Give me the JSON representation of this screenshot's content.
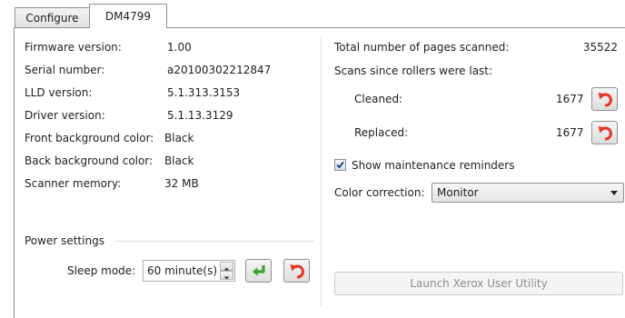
{
  "tabs": [
    {
      "label": "Configure"
    },
    {
      "label": "DM4799"
    }
  ],
  "device_info": {
    "firmware": {
      "label": "Firmware version:",
      "value": "1.00"
    },
    "serial": {
      "label": "Serial number:",
      "value": "a20100302212847"
    },
    "lld": {
      "label": "LLD version:",
      "value": "5.1.313.3153"
    },
    "driver": {
      "label": "Driver version:",
      "value": "5.1.13.3129"
    },
    "front_bg": {
      "label": "Front background color:",
      "value": "Black"
    },
    "back_bg": {
      "label": "Back background color:",
      "value": "Black"
    },
    "memory": {
      "label": "Scanner memory:",
      "value": "32 MB"
    }
  },
  "power": {
    "group_label": "Power settings",
    "sleep_label": "Sleep mode:",
    "sleep_value": "60 minute(s)"
  },
  "stats": {
    "total_label": "Total number of pages scanned:",
    "total_value": "35522",
    "rollers_label": "Scans since rollers were last:",
    "cleaned_label": "Cleaned:",
    "cleaned_value": "1677",
    "replaced_label": "Replaced:",
    "replaced_value": "1677"
  },
  "maintenance": {
    "checkbox_label": "Show maintenance reminders",
    "checked": true
  },
  "color_correction": {
    "label": "Color correction:",
    "selected": "Monitor"
  },
  "launch_button": {
    "label": "Launch Xerox User Utility"
  },
  "colors": {
    "reset_arrow": "#e8342a",
    "apply_arrow": "#3aa12f",
    "disabled_text": "#8d8d8d"
  }
}
